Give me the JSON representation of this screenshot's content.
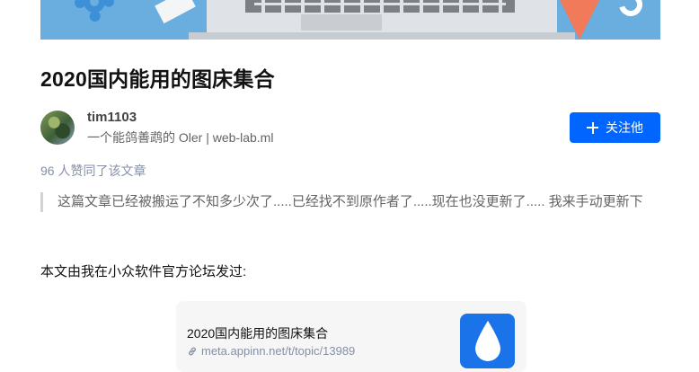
{
  "article": {
    "title": "2020国内能用的图床集合",
    "author": {
      "name": "tim1103",
      "bio": "一个能鸽善鹉的 Oler | web-lab.ml"
    },
    "follow_button_label": "关注他",
    "likes_text": "96 人赞同了该文章",
    "quote": "这篇文章已经被搬运了不知多少次了.....已经找不到原作者了.....现在也没更新了..... 我来手动更新下",
    "paragraph": "本文由我在小众软件官方论坛发过:",
    "link_card": {
      "title": "2020国内能用的图床集合",
      "url": "meta.appinn.net/t/topic/13989"
    }
  },
  "colors": {
    "accent": "#0066ff",
    "banner": "#6aaee0",
    "muted": "#8590a6",
    "thumb": "#1a73e8"
  },
  "icons": {
    "follow": "plus-icon",
    "link": "link-icon",
    "thumbnail": "water-drop-icon"
  }
}
